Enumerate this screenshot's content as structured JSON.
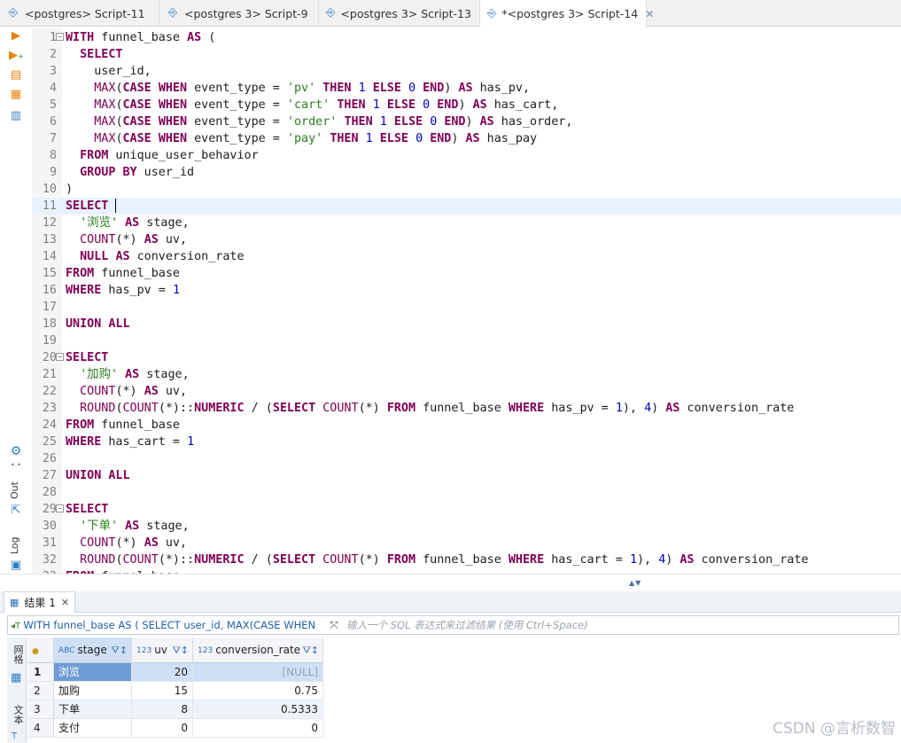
{
  "tabs": [
    {
      "label": "<postgres> Script-11",
      "active": false
    },
    {
      "label": "<postgres 3> Script-9",
      "active": false
    },
    {
      "label": "<postgres 3> Script-13",
      "active": false
    },
    {
      "label": "*<postgres 3> Script-14",
      "active": true
    }
  ],
  "icons": {
    "tab": "sql-script-icon",
    "close": "close-icon",
    "execute": "execute-statement-icon",
    "execute_new_tab": "execute-new-tab-icon",
    "execute_script": "execute-script-icon",
    "execute_script_new_tab": "execute-script-new-tab-icon",
    "explain": "explain-plan-icon",
    "settings": "gear-icon",
    "output": "output-icon",
    "log": "log-icon",
    "grid": "grid-icon",
    "text": "text-icon",
    "filter": "filter-icon",
    "expand": "expand-icon"
  },
  "editor": {
    "lines": [
      "WITH funnel_base AS (",
      "  SELECT",
      "    user_id,",
      "    MAX(CASE WHEN event_type = 'pv' THEN 1 ELSE 0 END) AS has_pv,",
      "    MAX(CASE WHEN event_type = 'cart' THEN 1 ELSE 0 END) AS has_cart,",
      "    MAX(CASE WHEN event_type = 'order' THEN 1 ELSE 0 END) AS has_order,",
      "    MAX(CASE WHEN event_type = 'pay' THEN 1 ELSE 0 END) AS has_pay",
      "  FROM unique_user_behavior",
      "  GROUP BY user_id",
      ")",
      "SELECT ",
      "  '浏览' AS stage,",
      "  COUNT(*) AS uv,",
      "  NULL AS conversion_rate",
      "FROM funnel_base",
      "WHERE has_pv = 1",
      "",
      "UNION ALL",
      "",
      "SELECT",
      "  '加购' AS stage,",
      "  COUNT(*) AS uv,",
      "  ROUND(COUNT(*)::NUMERIC / (SELECT COUNT(*) FROM funnel_base WHERE has_pv = 1), 4) AS conversion_rate",
      "FROM funnel_base",
      "WHERE has_cart = 1",
      "",
      "UNION ALL",
      "",
      "SELECT",
      "  '下单' AS stage,",
      "  COUNT(*) AS uv,",
      "  ROUND(COUNT(*)::NUMERIC / (SELECT COUNT(*) FROM funnel_base WHERE has_cart = 1), 4) AS conversion_rate",
      "FROM funnel_base"
    ],
    "fold_lines": [
      1,
      20,
      29
    ],
    "current_line": 11
  },
  "side_labels": {
    "out": "Out",
    "log": "Log"
  },
  "results": {
    "tab_label": "结果 1",
    "query_preview": "WITH funnel_base AS ( SELECT user_id, MAX(CASE WHEN",
    "filter_placeholder": "输入一个 SQL 表达式来过滤结果 (使用 Ctrl+Space)",
    "side": {
      "grid_label": "网格",
      "text_label": "文本"
    },
    "columns": [
      {
        "type": "ABC",
        "name": "stage"
      },
      {
        "type": "123",
        "name": "uv"
      },
      {
        "type": "123",
        "name": "conversion_rate"
      }
    ],
    "rows": [
      {
        "num": "1",
        "stage": "浏览",
        "uv": "20",
        "conversion_rate": "[NULL]"
      },
      {
        "num": "2",
        "stage": "加购",
        "uv": "15",
        "conversion_rate": "0.75"
      },
      {
        "num": "3",
        "stage": "下单",
        "uv": "8",
        "conversion_rate": "0.5333"
      },
      {
        "num": "4",
        "stage": "支付",
        "uv": "0",
        "conversion_rate": "0"
      }
    ]
  },
  "watermark": "CSDN @言析数智"
}
